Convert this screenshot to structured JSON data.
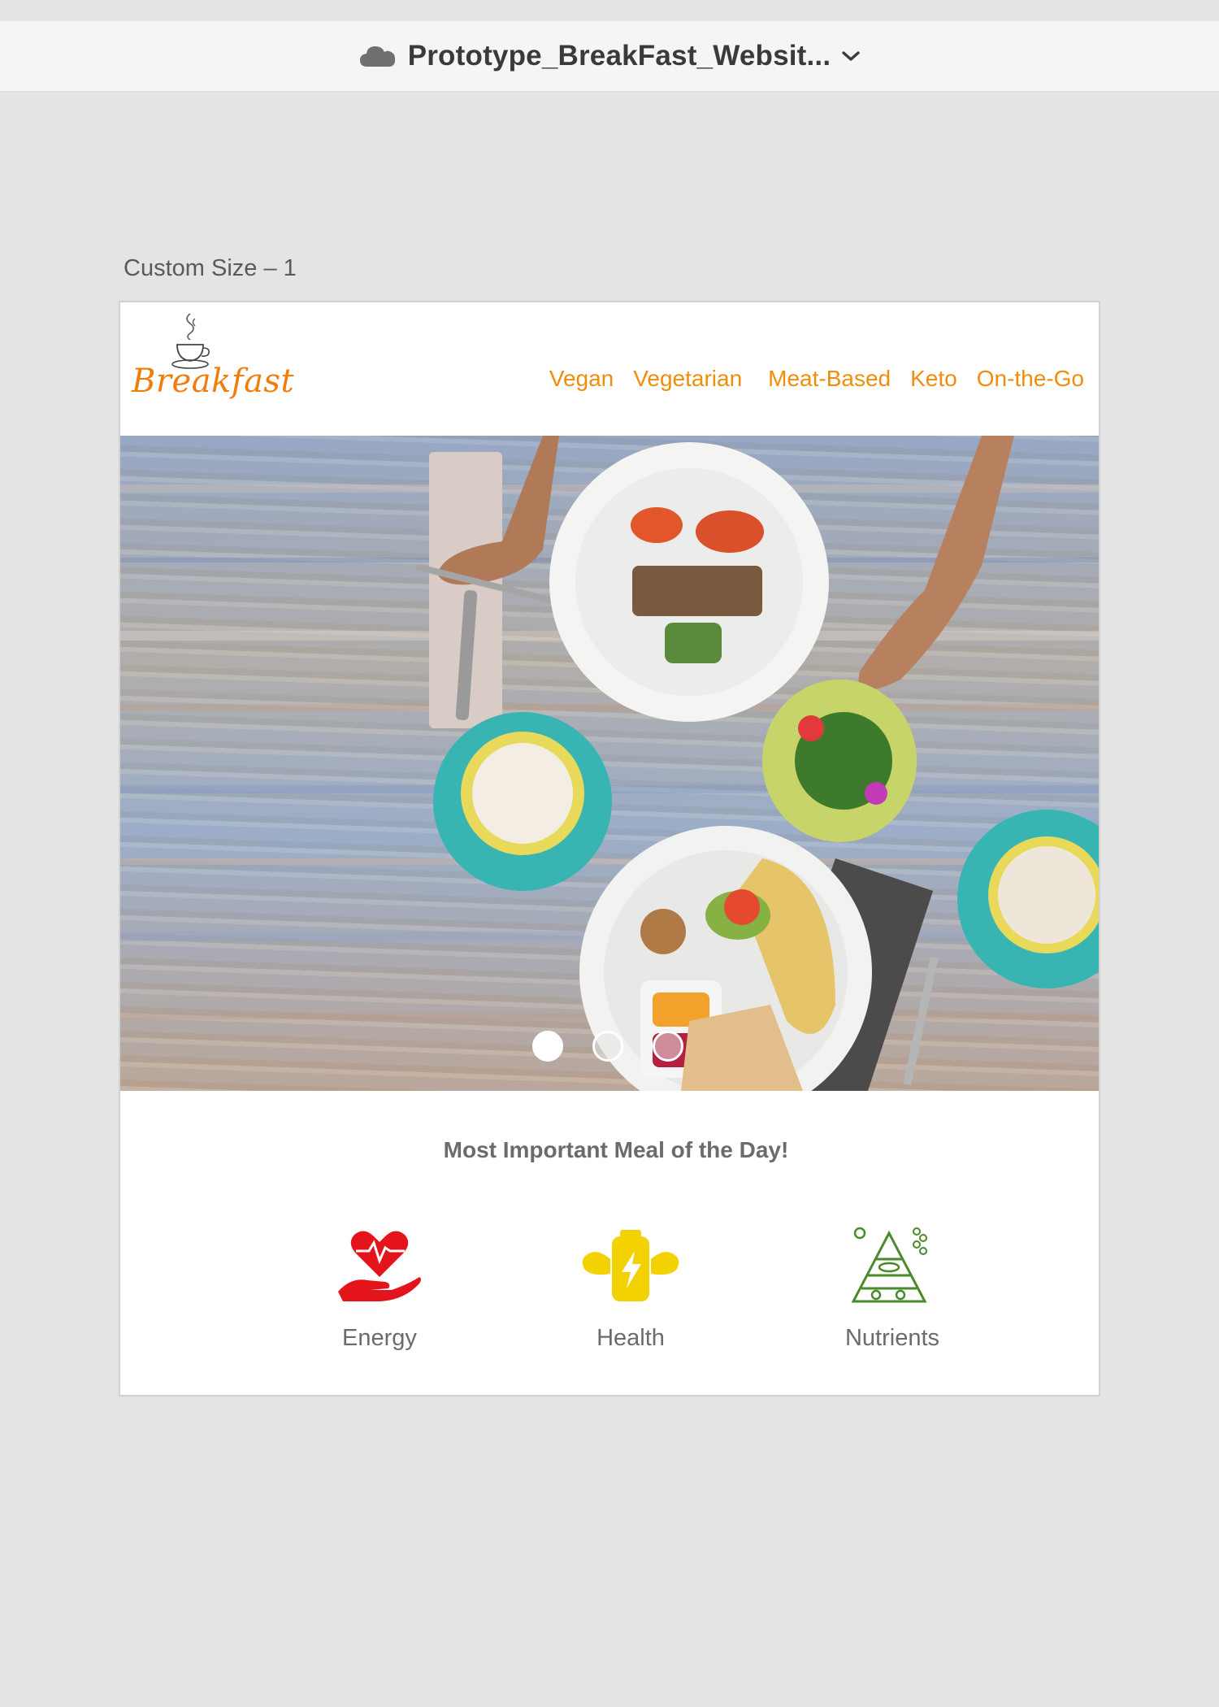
{
  "doc": {
    "title": "Prototype_BreakFast_Websit..."
  },
  "artboard": {
    "label": "Custom Size – 1"
  },
  "site": {
    "logo_text": "Breakfast",
    "nav": [
      "Vegan",
      "Vegetarian",
      "Meat-Based",
      "Keto",
      "On-the-Go"
    ]
  },
  "carousel": {
    "slide_count": 3,
    "active_index": 0
  },
  "headline": "Most Important Meal of the Day!",
  "features": [
    {
      "label": "Energy",
      "icon": "heart-hand-icon",
      "color": "#e3141b"
    },
    {
      "label": "Health",
      "icon": "battery-muscle-icon",
      "color": "#f2d200"
    },
    {
      "label": "Nutrients",
      "icon": "food-pyramid-icon",
      "color": "#4a8a2a"
    }
  ],
  "colors": {
    "brand_orange": "#f08d0a",
    "canvas_bg": "#e4e4e4"
  }
}
